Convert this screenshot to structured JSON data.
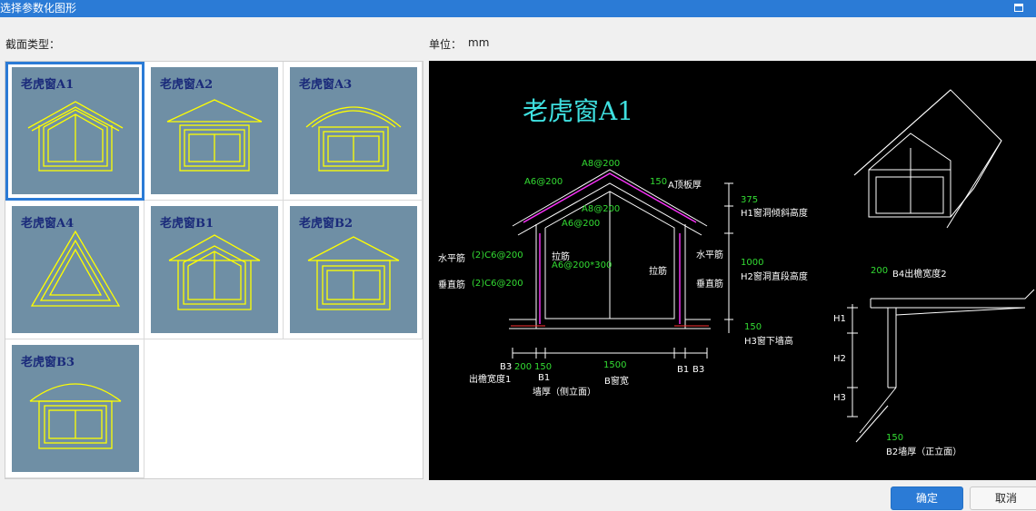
{
  "window": {
    "title": "选择参数化图形"
  },
  "labels": {
    "section_type": "截面类型：",
    "unit_label": "单位：",
    "unit_value": "mm"
  },
  "thumbnails": [
    {
      "name": "老虎窗A1"
    },
    {
      "name": "老虎窗A2"
    },
    {
      "name": "老虎窗A3"
    },
    {
      "name": "老虎窗A4"
    },
    {
      "name": "老虎窗B1"
    },
    {
      "name": "老虎窗B2"
    },
    {
      "name": "老虎窗B3"
    }
  ],
  "selected_index": 0,
  "preview": {
    "title": "老虎窗A1",
    "annotations": {
      "a8_200_top": "A8@200",
      "a6_200_left": "A6@200",
      "a8_200_mid": "A8@200",
      "a6_200_mid": "A6@200",
      "a_roof_thick_val": "150",
      "a_roof_thick": "A顶板厚",
      "h1_val": "375",
      "h1_text": "H1窗洞倾斜高度",
      "h2_val": "1000",
      "h2_text": "H2窗洞直段高度",
      "h3_val": "150",
      "h3_text": "H3窗下墙高",
      "horiz_bar_left": "水平筋",
      "horiz_bar_left_spec": "(2)C6@200",
      "vert_bar_left": "垂直筋",
      "vert_bar_left_spec": "(2)C6@200",
      "tie_bar": "拉筋",
      "tie_bar_spec": "A6@200*300",
      "horiz_bar_right": "水平筋",
      "tie_bar_right": "拉筋",
      "vert_bar_right": "垂直筋",
      "b3_left": "B3",
      "dim_200": "200",
      "dim_150": "150",
      "b1_left": "B1",
      "dim_1500": "1500",
      "b1_right": "B1",
      "b3_right": "B3",
      "eave_width": "出檐宽度1",
      "wall_thick_side": "墙厚（侧立面）",
      "b_window_width": "B窗宽",
      "dim_200_b4": "200",
      "b4_text": "B4出檐宽度2",
      "h1": "H1",
      "h2": "H2",
      "h3": "H3",
      "dim_150_b2": "150",
      "b2_text": "B2墙厚（正立面）"
    }
  },
  "buttons": {
    "ok": "确定",
    "cancel": "取消"
  },
  "colors": {
    "accent": "#2b7bd6",
    "thumb_bg": "#6f8fa5",
    "drawing_yellow": "#ffff00",
    "dim_green": "#33dd33",
    "title_cyan": "#3fe0e0"
  }
}
